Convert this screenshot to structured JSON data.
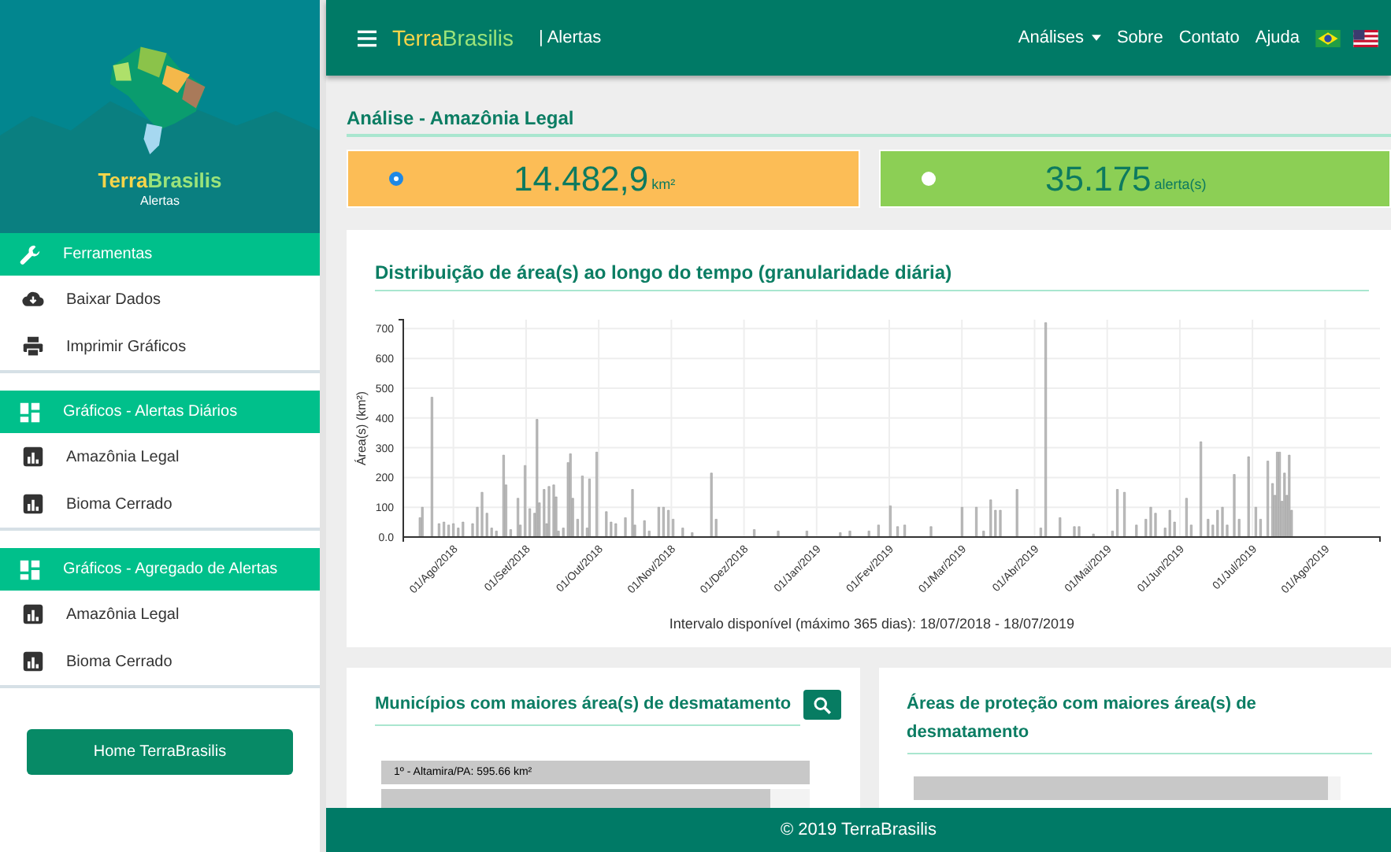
{
  "sidebar": {
    "logo": {
      "brand_a": "Terra",
      "brand_b": "Brasilis",
      "subtitle": "Alertas"
    },
    "sections": [
      {
        "title": "Ferramentas",
        "kind": "tools",
        "items": [
          {
            "label": "Baixar Dados",
            "kind": "download"
          },
          {
            "label": "Imprimir Gráficos",
            "kind": "print"
          }
        ]
      },
      {
        "title": "Gráficos - Alertas Diários",
        "kind": "charts",
        "items": [
          {
            "label": "Amazônia Legal",
            "kind": "chart"
          },
          {
            "label": "Bioma Cerrado",
            "kind": "chart"
          }
        ]
      },
      {
        "title": "Gráficos - Agregado de Alertas",
        "kind": "charts",
        "items": [
          {
            "label": "Amazônia Legal",
            "kind": "chart"
          },
          {
            "label": "Bioma Cerrado",
            "kind": "chart"
          }
        ]
      }
    ],
    "home_button": "Home TerraBrasilis"
  },
  "topbar": {
    "brand_a": "Terra",
    "brand_b": "Brasilis",
    "section": "| Alertas",
    "menu": [
      {
        "label": "Análises",
        "dropdown": true
      },
      {
        "label": "Sobre",
        "dropdown": false
      },
      {
        "label": "Contato",
        "dropdown": false
      },
      {
        "label": "Ajuda",
        "dropdown": false
      }
    ],
    "languages": [
      {
        "kind": "br"
      },
      {
        "kind": "us"
      }
    ]
  },
  "page_title": "Análise - Amazônia Legal",
  "stats": [
    {
      "value": "14.482,9",
      "unit": "km²",
      "selected": true,
      "color": "#fcbd56"
    },
    {
      "value": "35.175",
      "unit": "alerta(s)",
      "selected": false,
      "color": "#8ccf55"
    }
  ],
  "chart_card": {
    "title": "Distribuição de área(s) ao longo do tempo (granularidade diária)",
    "y_axis_label": "Área(s) (km²)",
    "y_ticks": [
      "700",
      "600",
      "500",
      "400",
      "300",
      "200",
      "100",
      "0.0"
    ],
    "x_ticks": [
      "01/Ago/2018",
      "01/Set/2018",
      "01/Out/2018",
      "01/Nov/2018",
      "01/Dez/2018",
      "01/Jan/2019",
      "01/Fev/2019",
      "01/Mar/2019",
      "01/Abr/2019",
      "01/Mai/2019",
      "01/Jun/2019",
      "01/Jul/2019",
      "01/Ago/2019"
    ],
    "caption": "Intervalo disponível (máximo 365 dias): 18/07/2018 - 18/07/2019"
  },
  "bottom_cards": [
    {
      "title": "Municípios com maiores área(s) de desmatamento",
      "search_button": true,
      "bars": [
        {
          "label": "1º - Altamira/PA: 595.66 km²",
          "level": 1
        },
        {
          "level": 0.91
        }
      ]
    },
    {
      "title": "Áreas de proteção com maiores área(s) de desmatamento",
      "search_button": false,
      "bars": [
        {
          "level": 0.97
        }
      ]
    }
  ],
  "footer": "© 2019 TerraBrasilis"
}
